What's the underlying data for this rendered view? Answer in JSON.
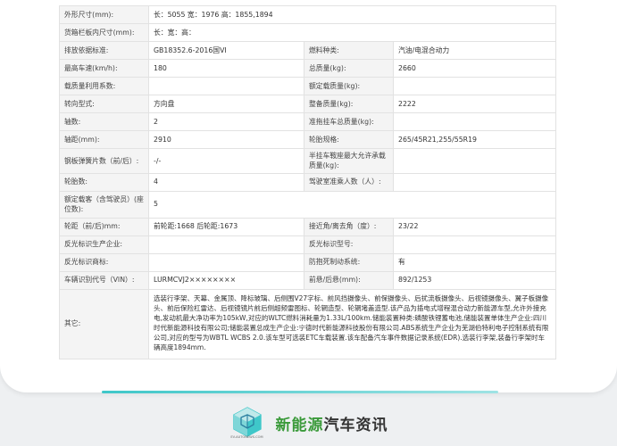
{
  "rows": [
    {
      "k1": "外形尺寸(mm):",
      "v1": "长：5055 宽：1976 高：1855,1894",
      "span": true
    },
    {
      "k1": "货箱栏板内尺寸(mm):",
      "v1": "长：宽：高：",
      "span": true
    },
    {
      "k1": "排放依据标准:",
      "v1": "GB18352.6-2016国VI",
      "k2": "燃料种类:",
      "v2": "汽油/电混合动力"
    },
    {
      "k1": "最高车速(km/h):",
      "v1": "180",
      "k2": "总质量(kg):",
      "v2": "2660"
    },
    {
      "k1": "载质量利用系数:",
      "v1": "",
      "k2": "额定载质量(kg):",
      "v2": ""
    },
    {
      "k1": "转向型式:",
      "v1": "方向盘",
      "k2": "整备质量(kg):",
      "v2": "2222"
    },
    {
      "k1": "轴数:",
      "v1": "2",
      "k2": "准拖挂车总质量(kg):",
      "v2": ""
    },
    {
      "k1": "轴距(mm):",
      "v1": "2910",
      "k2": "轮胎规格:",
      "v2": "265/45R21,255/55R19"
    },
    {
      "k1": "钢板弹簧片数（前/后）:",
      "v1": "-/-",
      "k2": "半挂车鞍座最大允许承载质量(kg):",
      "v2": ""
    },
    {
      "k1": "轮胎数:",
      "v1": "4",
      "k2": "驾驶室准乘人数（人）:",
      "v2": ""
    },
    {
      "k1": "额定载客（含驾驶员）(座位数):",
      "v1": "5",
      "span": true
    },
    {
      "k1": "轮距（前/后)mm:",
      "v1": "前轮距:1668 后轮距:1673",
      "k2": "接近角/离去角（度）:",
      "v2": "23/22"
    },
    {
      "k1": "反光标识生产企业:",
      "v1": "",
      "k2": "反光标识型号:",
      "v2": ""
    },
    {
      "k1": "反光标识商标:",
      "v1": "",
      "k2": "防抱死制动系统:",
      "v2": "有"
    },
    {
      "k1": "车辆识别代号（VIN）:",
      "v1": "LURMCVJ2××××××××",
      "k2": "前悬/后悬(mm):",
      "v2": "892/1253"
    }
  ],
  "other": {
    "label": "其它:",
    "text": "选装行李架、天幕、金属顶、降标玻璃、后侧围V27字标、前风挡摄像头、前保摄像头、后扰流板摄像头、后视镜摄像头、翼子板摄像头、前后保险杠雷达、后视镜镜片前后侧超频雷图标、轮辋造型、轮辋堵盖造型.该产品为插电式增程混合动力新能源车型,允许外接充电,发动机最大净功率为105kW,对应的WLTC燃料消耗量为1.33L/100km.储能装置种类:磷酸铁锂蓄电池,储能装置单体生产企业:四川时代新能源科技有限公司;储能装置总成生产企业:宁德时代新能源科技股份有限公司.ABS系统生产企业为芜湖伯特利电子控制系统有限公司,对应的型号为WBTL WCBS 2.0.该车型可选装ETC车载装置.该车配备汽车事件数据记录系统(EDR).选装行李架,装备行李架时车辆高度1894mm."
  },
  "brand": {
    "name_green": "新能源",
    "name_dark": "汽车资讯",
    "logo_caption": "EV-AUTONEWS.COM",
    "accent": "#3fc7c9",
    "green": "#3a9a3a"
  }
}
